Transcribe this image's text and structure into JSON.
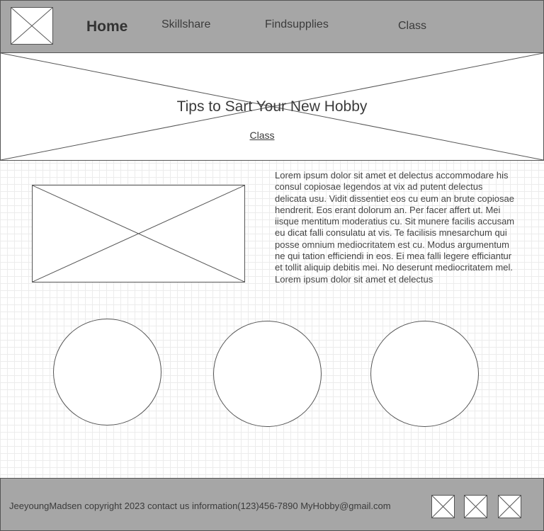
{
  "nav": {
    "home": "Home",
    "skillshare": "Skillshare",
    "findsupplies": "Findsupplies",
    "class": "Class"
  },
  "hero": {
    "title": "Tips to Sart Your New Hobby",
    "link": "Class"
  },
  "content": {
    "body_text": "Lorem ipsum dolor sit amet et delectus accommodare his consul copiosae legendos at vix ad putent delectus delicata usu. Vidit dissentiet eos cu eum an brute copiosae hendrerit. Eos erant dolorum an. Per facer affert ut. Mei iisque mentitum moderatius cu. Sit munere facilis accusam eu dicat falli consulatu at vis. Te facilisis mnesarchum qui posse omnium mediocritatem est cu. Modus argumentum ne qui tation efficiendi in eos. Ei mea falli legere efficiantur et tollit aliquip debitis mei. No deserunt mediocritatem mel. Lorem ipsum dolor sit amet et delectus"
  },
  "footer": {
    "text": "JeeyoungMadsen copyright 2023 contact us information(123)456-7890 MyHobby@gmail.com"
  },
  "placeholders": {
    "image_icon": "x-placeholder"
  }
}
